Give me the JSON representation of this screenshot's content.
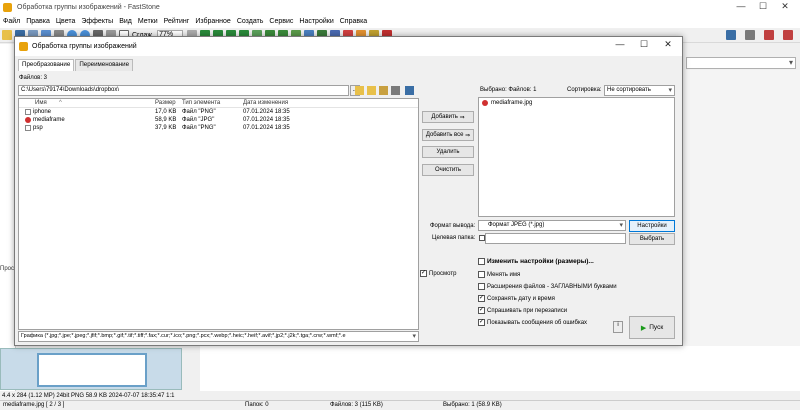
{
  "app": {
    "title": "Обработка группы изображений - FastStone",
    "menu": [
      "Файл",
      "Правка",
      "Цвета",
      "Эффекты",
      "Вид",
      "Метки",
      "Рейтинг",
      "Избранное",
      "Создать",
      "Сервис",
      "Настройки",
      "Справка"
    ],
    "toolbar": {
      "smooth_label": "Сглаж.",
      "zoom_value": "77%"
    }
  },
  "left_panel": {
    "label": "Прос"
  },
  "status_top": {
    "text": "4.4 x 284 (1.12 MP)  24bit  PNG   58.9 KB  2024-07-07 18:35:47  1:1"
  },
  "statusbar": {
    "file": "mediaframe.jpg [ 2 / 3 ]",
    "folders": "Папок: 0",
    "files": "Файлов: 3 (115 KB)",
    "selected": "Выбрано: 1 (58.9 KB)"
  },
  "dialog": {
    "title": "Обработка группы изображений",
    "tabs": [
      "Преобразование",
      "Переименование"
    ],
    "files_count": "Файлов: 3",
    "path": "C:\\Users\\79174\\Downloads\\dropbox\\",
    "path_btn": "...",
    "columns": {
      "name": "Имя",
      "size": "Размер",
      "type": "Тип элемента",
      "date": "Дата изменения"
    },
    "files": [
      {
        "name": "iphone",
        "size": "17,0 KB",
        "type": "Файл \"PNG\"",
        "date": "07.01.2024 18:35"
      },
      {
        "name": "mediaframe",
        "size": "58,9 KB",
        "type": "Файл \"JPG\"",
        "date": "07.01.2024 18:35"
      },
      {
        "name": "psp",
        "size": "37,9 KB",
        "type": "Файл \"PNG\"",
        "date": "07.01.2024 18:35"
      }
    ],
    "filter": "Графика (*.jpg;*.jpe;*.jpeg;*.jfif;*.bmp;*.gif;*.tif;*.tiff;*.fax;*.cur;*.ico;*.png;*.pcx;*.webp;*.heic;*.heif;*.avif;*.jp2;*.j2k;*.tga;*.crw;*.wmf;*.e",
    "buttons": {
      "add": "Добавить",
      "add_all": "Добавить все",
      "remove": "Удалить",
      "clear": "Очистить"
    },
    "preview_label": "Просмотр",
    "selected_label": "Выбрано: Файлов: 1",
    "sort_label": "Сортировка:",
    "sort_value": "Не сортировать",
    "selected_files": [
      "mediaframe.jpg"
    ],
    "format_label": "Формат вывода:",
    "format_value": "Формат JPEG (*.jpg)",
    "settings_btn": "Настройки",
    "folder_label": "Целевая папка:",
    "folder_value": "",
    "browse_btn": "Выбрать",
    "options": [
      {
        "label": "Изменить настройки (размеры)...",
        "checked": false,
        "bold": true
      },
      {
        "label": "Менять имя",
        "checked": false,
        "bold": false
      },
      {
        "label": "Расширения файлов - ЗАГЛАВНЫМИ буквами",
        "checked": false,
        "bold": false
      },
      {
        "label": "Сохранять дату и время",
        "checked": true,
        "bold": false
      },
      {
        "label": "Спрашивать при перезаписи",
        "checked": true,
        "bold": false
      },
      {
        "label": "Показывать сообщения об ошибках",
        "checked": true,
        "bold": false
      }
    ],
    "run_btn": "Пуск",
    "window_btns": [
      "—",
      "☐",
      "✕"
    ]
  }
}
